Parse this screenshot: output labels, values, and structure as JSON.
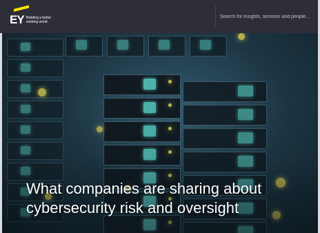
{
  "header": {
    "logo_text": "EY",
    "tagline": "Building a better working world",
    "search_placeholder": "Search for insights, services and people..."
  },
  "hero": {
    "headline_line1": "What companies are sharing about",
    "headline_line2": "cybersecurity risk and oversight"
  },
  "colors": {
    "brand_yellow": "#ffe600",
    "header_bg": "#2e2e38",
    "led_teal": "#5ed8cf",
    "led_yellow": "#f4e35a"
  },
  "icons": [
    "ey-logo-icon"
  ]
}
